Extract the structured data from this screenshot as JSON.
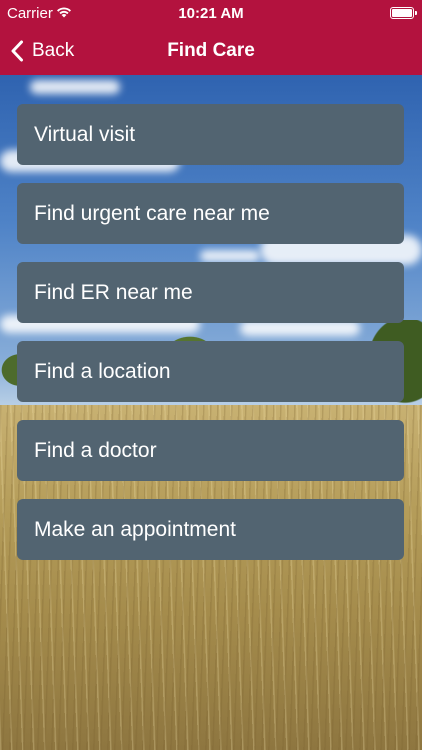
{
  "status_bar": {
    "carrier": "Carrier",
    "time": "10:21 AM",
    "wifi_icon": "wifi-icon",
    "battery_icon": "battery-icon"
  },
  "nav": {
    "back_label": "Back",
    "back_icon": "chevron-left-icon",
    "title": "Find Care",
    "bar_color": "#b3123e"
  },
  "menu": {
    "button_color": "#526471",
    "items": [
      {
        "label": "Virtual visit"
      },
      {
        "label": "Find urgent care near me"
      },
      {
        "label": "Find ER near me"
      },
      {
        "label": "Find a location"
      },
      {
        "label": "Find a doctor"
      },
      {
        "label": "Make an appointment"
      }
    ]
  }
}
